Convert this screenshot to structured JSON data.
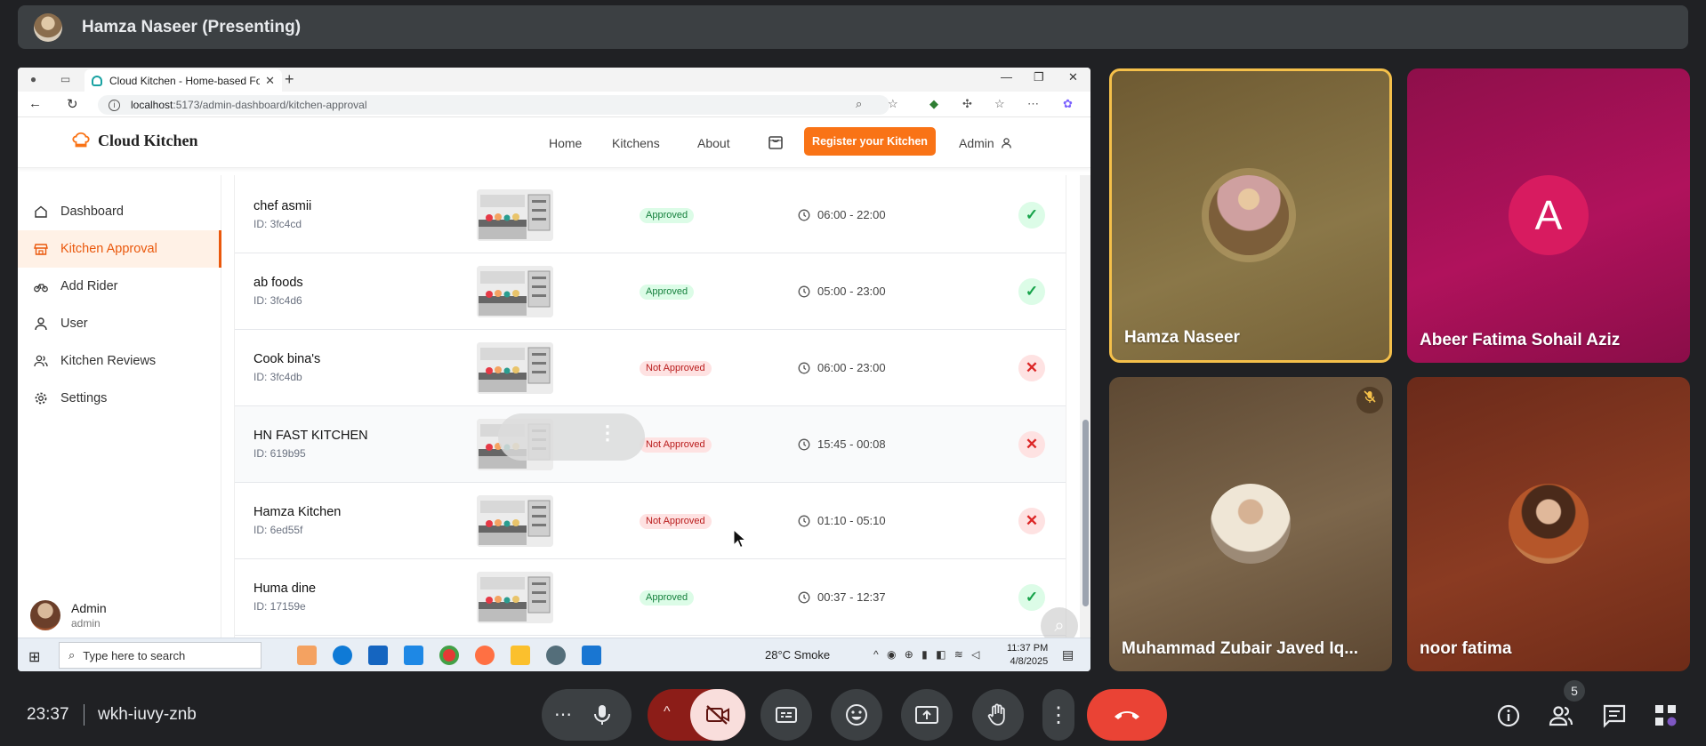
{
  "presenter": {
    "name": "Hamza Naseer (Presenting)"
  },
  "browser": {
    "tab_title": "Cloud Kitchen - Home-based Foo",
    "url_host": "localhost",
    "url_path": ":5173/admin-dashboard/kitchen-approval"
  },
  "app": {
    "brand": "Cloud Kitchen",
    "nav": {
      "home": "Home",
      "kitchens": "Kitchens",
      "about": "About",
      "register": "Register your Kitchen",
      "admin": "Admin"
    },
    "accent_color": "#f97316"
  },
  "sidebar": {
    "items": [
      {
        "label": "Dashboard",
        "icon": "home-icon"
      },
      {
        "label": "Kitchen Approval",
        "icon": "store-icon",
        "active": true
      },
      {
        "label": "Add Rider",
        "icon": "bike-icon"
      },
      {
        "label": "User",
        "icon": "user-icon"
      },
      {
        "label": "Kitchen Reviews",
        "icon": "users-icon"
      },
      {
        "label": "Settings",
        "icon": "gear-icon"
      }
    ],
    "user": {
      "name": "Admin",
      "role": "admin"
    }
  },
  "kitchens": [
    {
      "name": "chef asmii",
      "id": "ID: 3fc4cd",
      "status": "Approved",
      "hours": "06:00 - 22:00",
      "action": "approve"
    },
    {
      "name": "ab foods",
      "id": "ID: 3fc4d6",
      "status": "Approved",
      "hours": "05:00 - 23:00",
      "action": "approve"
    },
    {
      "name": "Cook bina's",
      "id": "ID: 3fc4db",
      "status": "Not Approved",
      "hours": "06:00 - 23:00",
      "action": "reject"
    },
    {
      "name": "HN FAST KITCHEN",
      "id": "ID: 619b95",
      "status": "Not Approved",
      "hours": "15:45 - 00:08",
      "action": "reject"
    },
    {
      "name": "Hamza Kitchen",
      "id": "ID: 6ed55f",
      "status": "Not Approved",
      "hours": "01:10 - 05:10",
      "action": "reject"
    },
    {
      "name": "Huma dine",
      "id": "ID: 17159e",
      "status": "Approved",
      "hours": "00:37 - 12:37",
      "action": "approve"
    }
  ],
  "taskbar": {
    "search_placeholder": "Type here to search",
    "weather": "28°C  Smoke",
    "time": "11:37 PM",
    "date": "4/8/2025"
  },
  "participants": [
    {
      "name": "Hamza Naseer"
    },
    {
      "name": "Abeer Fatima Sohail Aziz",
      "initial": "A"
    },
    {
      "name": "Muhammad Zubair Javed Iq..."
    },
    {
      "name": "noor fatima"
    }
  ],
  "meeting": {
    "time": "23:37",
    "code": "wkh-iuvy-znb",
    "participant_count": "5"
  }
}
